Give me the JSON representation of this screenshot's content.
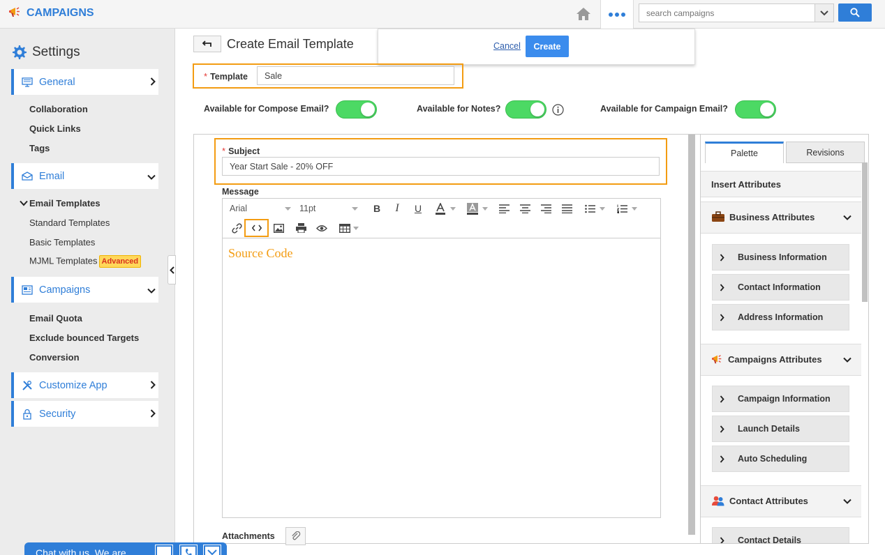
{
  "app": {
    "title": "CAMPAIGNS"
  },
  "search": {
    "placeholder": "search campaigns"
  },
  "sidebar": {
    "heading": "Settings",
    "sections": [
      {
        "label": "General",
        "icon": "monitor-icon",
        "caret": "chevron-right-icon"
      },
      {
        "label": "Email",
        "icon": "envelope-icon",
        "caret": "chevron-down-icon"
      },
      {
        "label": "Campaigns",
        "icon": "newspaper-icon",
        "caret": "chevron-down-icon"
      },
      {
        "label": "Customize App",
        "icon": "tools-icon",
        "caret": "chevron-right-icon"
      },
      {
        "label": "Security",
        "icon": "lock-icon",
        "caret": "chevron-right-icon"
      }
    ],
    "general_items": [
      "Collaboration",
      "Quick Links",
      "Tags"
    ],
    "email_group": "Email Templates",
    "email_items": [
      "Standard Templates",
      "Basic Templates",
      "MJML Templates"
    ],
    "advanced_badge": "Advanced",
    "campaign_items": [
      "Email Quota",
      "Exclude bounced Targets",
      "Conversion"
    ]
  },
  "page": {
    "title": "Create Email Template"
  },
  "actions": {
    "cancel": "Cancel",
    "create": "Create"
  },
  "form": {
    "required_mark": "*",
    "template_label": "Template",
    "template_value": "Sale",
    "toggles": [
      {
        "label": "Available for Compose Email?",
        "on": true
      },
      {
        "label": "Available for Notes?",
        "on": true
      },
      {
        "label": "Available for Campaign Email?",
        "on": true
      }
    ],
    "subject_label": "Subject",
    "subject_value": "Year Start Sale - 20% OFF",
    "message_label": "Message",
    "attachments_label": "Attachments"
  },
  "editor": {
    "font": "Arial",
    "size": "11pt",
    "body_text": "Source Code"
  },
  "right_panel": {
    "tabs": [
      "Palette",
      "Revisions"
    ],
    "insert_attributes": "Insert Attributes",
    "groups": [
      {
        "title": "Business Attributes",
        "icon": "briefcase-icon",
        "items": [
          "Business Information",
          "Contact Information",
          "Address Information"
        ]
      },
      {
        "title": "Campaigns Attributes",
        "icon": "megaphone-icon",
        "items": [
          "Campaign Information",
          "Launch Details",
          "Auto Scheduling"
        ]
      },
      {
        "title": "Contact Attributes",
        "icon": "people-icon",
        "items": [
          "Contact Details"
        ]
      }
    ]
  },
  "chat": {
    "text": "Chat with us, We are"
  },
  "colors": {
    "accent": "#2f7ed8",
    "highlight": "#f39c12",
    "toggle_on": "#4cd964"
  }
}
